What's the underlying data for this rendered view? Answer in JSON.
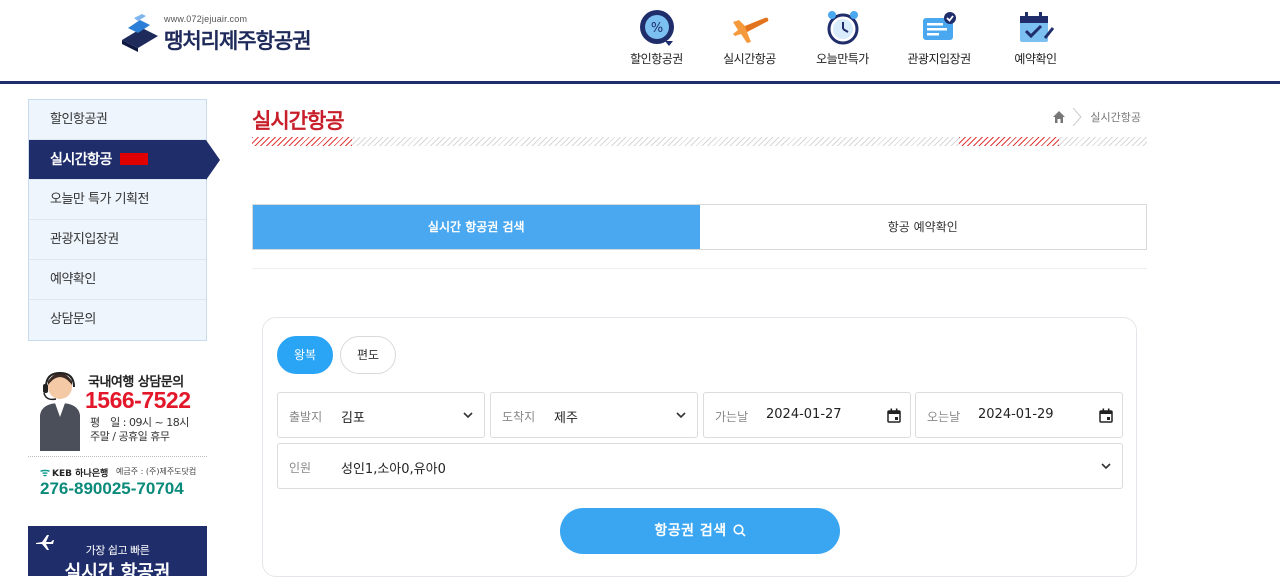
{
  "header": {
    "logo_url": "www.072jejuair.com",
    "logo_text": "땡처리제주항공권",
    "nav": [
      {
        "label": "할인항공권",
        "icon": "discount-icon"
      },
      {
        "label": "실시간항공",
        "icon": "airplane-icon"
      },
      {
        "label": "오늘만특가",
        "icon": "alarm-clock-icon"
      },
      {
        "label": "관광지입장권",
        "icon": "ticket-icon"
      },
      {
        "label": "예약확인",
        "icon": "calendar-check-icon"
      }
    ]
  },
  "sidebar": {
    "items": [
      {
        "label": "할인항공권"
      },
      {
        "label": "실시간항공",
        "active": true
      },
      {
        "label": "오늘만 특가 기획전"
      },
      {
        "label": "관광지입장권"
      },
      {
        "label": "예약확인"
      },
      {
        "label": "상담문의"
      }
    ],
    "cs": {
      "title": "국내여행 상담문의",
      "phone": "1566-7522",
      "hours_line1": "평　일 : 09시 ~ 18시",
      "hours_line2": "주말 / 공휴일 휴무"
    },
    "bank": {
      "name": "KEB 하나은행",
      "holder": "예금주 : (주)제주도닷컴",
      "account": "276-890025-70704"
    },
    "promo": {
      "text": "가장 쉽고 빠른",
      "big": "실시간 항공권"
    }
  },
  "main": {
    "title": "실시간항공",
    "breadcrumb": "실시간항공",
    "tabs": [
      {
        "label": "실시간 항공권 검색",
        "active": true
      },
      {
        "label": "항공 예약확인",
        "active": false
      }
    ],
    "search": {
      "trip_types": [
        {
          "label": "왕복",
          "active": true
        },
        {
          "label": "편도",
          "active": false
        }
      ],
      "departure": {
        "label": "출발지",
        "value": "김포"
      },
      "arrival": {
        "label": "도착지",
        "value": "제주"
      },
      "go_date": {
        "label": "가는날",
        "value": "2024-01-27"
      },
      "return_date": {
        "label": "오는날",
        "value": "2024-01-29"
      },
      "passengers": {
        "label": "인원",
        "value": "성인1,소아0,유아0"
      },
      "search_button": "항공권 검색"
    }
  },
  "colors": {
    "navy": "#1f2d6b",
    "accent_blue": "#4aa8f0",
    "title_red": "#c81e2a",
    "phone_red": "#e3172a",
    "bank_green": "#0a8a7a"
  }
}
